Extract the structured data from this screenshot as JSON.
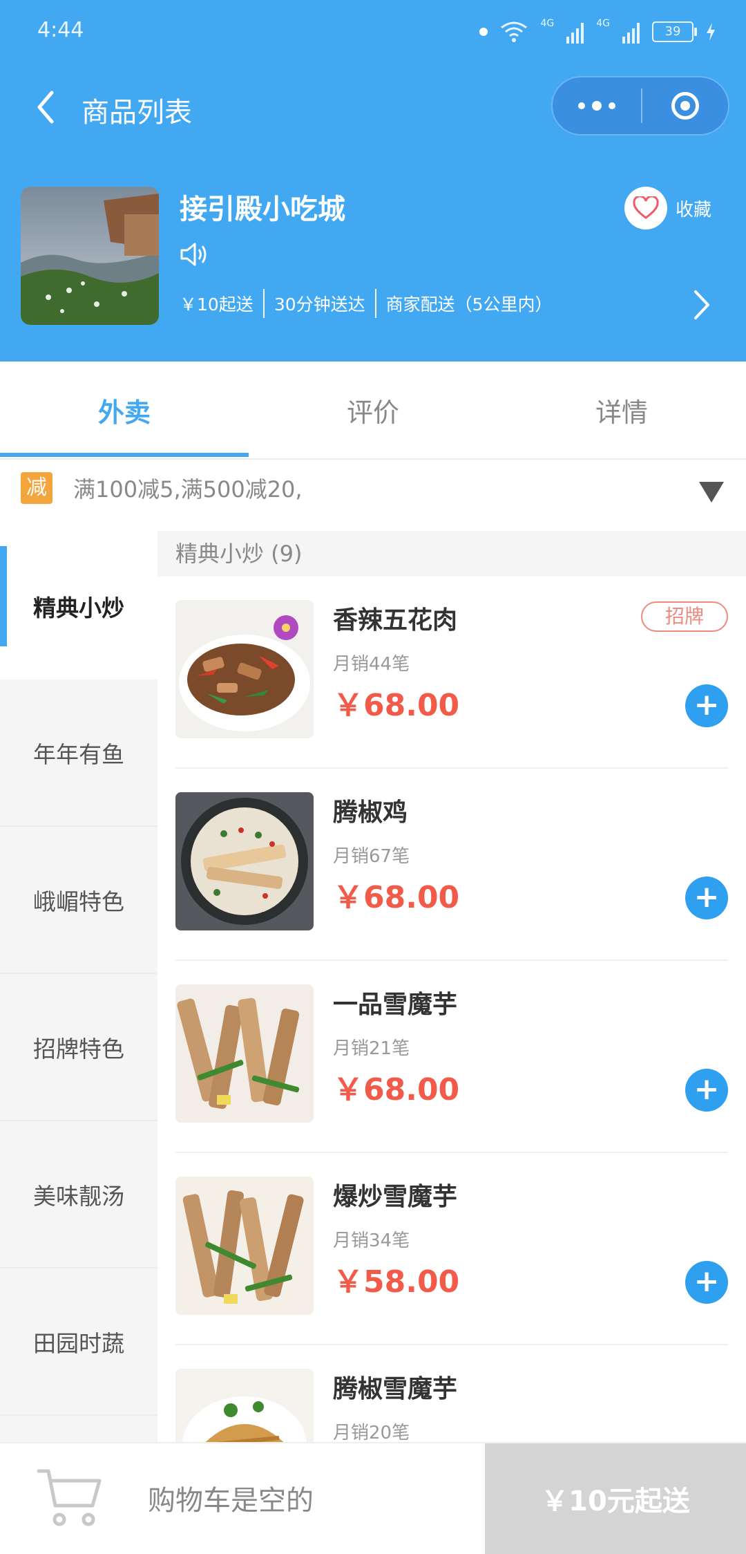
{
  "status_bar": {
    "time": "4:44",
    "battery": "39",
    "net1": "4G",
    "net2": "4G"
  },
  "nav": {
    "title": "商品列表"
  },
  "shop": {
    "name": "接引殿小吃城",
    "tags": [
      "￥10起送",
      "30分钟送达",
      "商家配送（5公里内）"
    ],
    "fav_label": "收藏"
  },
  "tabs": [
    {
      "label": "外卖",
      "active": true
    },
    {
      "label": "评价",
      "active": false
    },
    {
      "label": "详情",
      "active": false
    }
  ],
  "promo": {
    "badge": "减",
    "text": "满100减5,满500减20,"
  },
  "categories": [
    {
      "label": "精典小炒",
      "active": true
    },
    {
      "label": "年年有鱼",
      "active": false
    },
    {
      "label": "峨嵋特色",
      "active": false
    },
    {
      "label": "招牌特色",
      "active": false
    },
    {
      "label": "美味靓汤",
      "active": false
    },
    {
      "label": "田园时蔬",
      "active": false
    }
  ],
  "section": {
    "title": "精典小炒 (9)"
  },
  "products": [
    {
      "name": "香辣五花肉",
      "sales": "月销44笔",
      "price": "￥68.00",
      "badge": "招牌"
    },
    {
      "name": "腾椒鸡",
      "sales": "月销67笔",
      "price": "￥68.00"
    },
    {
      "name": "一品雪魔芋",
      "sales": "月销21笔",
      "price": "￥68.00"
    },
    {
      "name": "爆炒雪魔芋",
      "sales": "月销34笔",
      "price": "￥58.00"
    },
    {
      "name": "腾椒雪魔芋",
      "sales": "月销20笔",
      "price": ""
    }
  ],
  "cart": {
    "empty_text": "购物车是空的",
    "checkout": "￥10元起送"
  },
  "colors": {
    "primary": "#43a8f2",
    "price": "#f25a4a",
    "badge": "#f08a7e",
    "promo_badge": "#f3a43b"
  }
}
